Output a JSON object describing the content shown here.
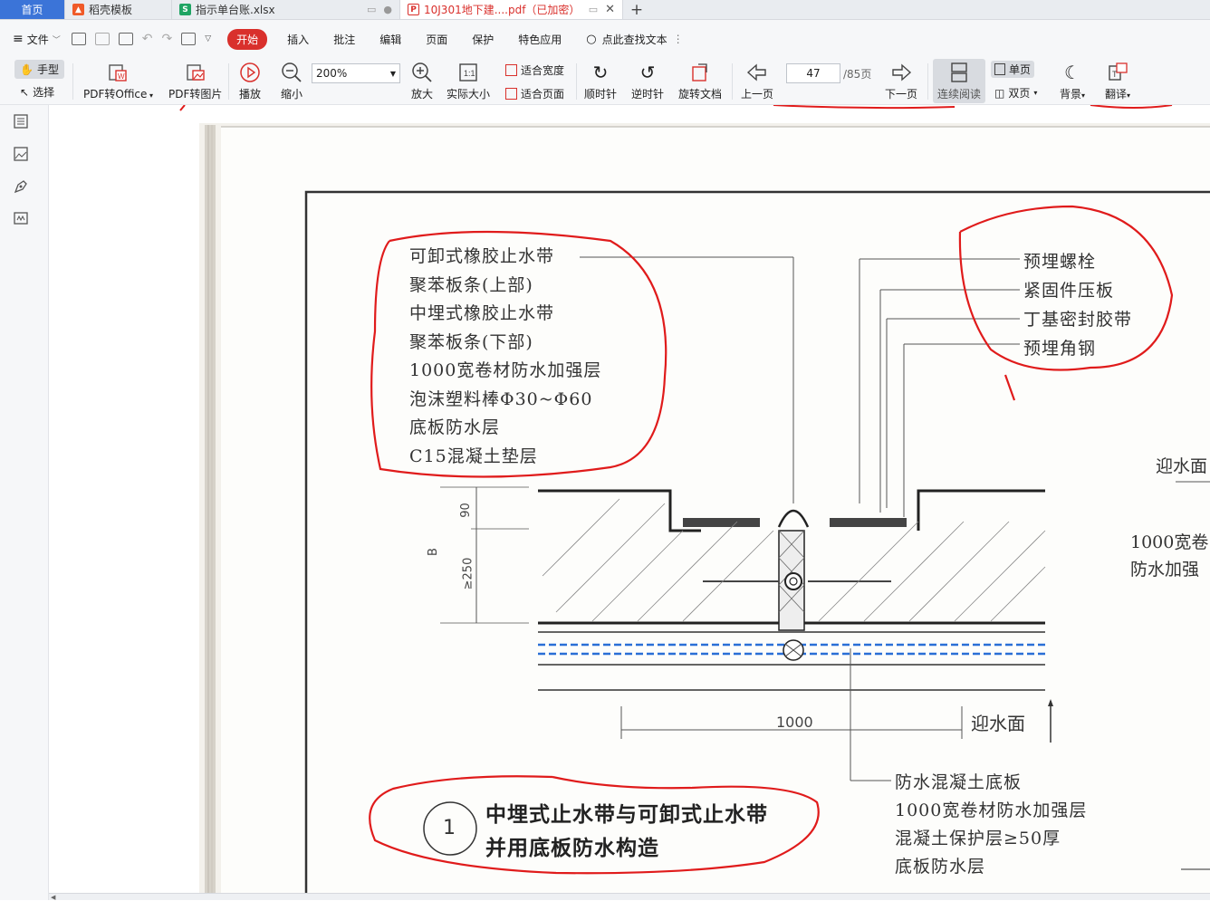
{
  "tabs": [
    {
      "label": "首页"
    },
    {
      "label": "稻壳模板"
    },
    {
      "label": "指示单台账.xlsx"
    },
    {
      "label": "10J301地下建....pdf（已加密）"
    }
  ],
  "menu": {
    "file": "文件",
    "items": [
      "开始",
      "插入",
      "批注",
      "编辑",
      "页面",
      "保护",
      "特色应用"
    ],
    "search": "点此查找文本"
  },
  "ribbon": {
    "hand": "手型",
    "select": "选择",
    "pdf_to_office": "PDF转Office",
    "pdf_to_image": "PDF转图片",
    "play": "播放",
    "zoom_out": "缩小",
    "zoom_value": "200%",
    "zoom_in": "放大",
    "actual_size": "实际大小",
    "fit_width": "适合宽度",
    "fit_page": "适合页面",
    "rotate_cw": "顺时针",
    "rotate_ccw": "逆时针",
    "rotate_doc": "旋转文档",
    "prev_page": "上一页",
    "page_current": "47",
    "page_total": "/85页",
    "next_page": "下一页",
    "continuous": "连续阅读",
    "single": "单页",
    "double": "双页",
    "background": "背景",
    "translate": "翻译"
  },
  "drawing": {
    "labels_left": [
      "可卸式橡胶止水带",
      "聚苯板条(上部)",
      "中埋式橡胶止水带",
      "聚苯板条(下部)",
      "1000宽卷材防水加强层",
      "泡沫塑料棒Φ30~Φ60",
      "底板防水层",
      "C15混凝土垫层"
    ],
    "labels_right": [
      "预埋螺栓",
      "紧固件压板",
      "丁基密封胶带",
      "预埋角钢"
    ],
    "labels_bottom": [
      "防水混凝土底板",
      "1000宽卷材防水加强层",
      "混凝土保护层≥50厚",
      "底板防水层"
    ],
    "side_label_1": "迎水面",
    "side_label_2": "1000宽卷",
    "side_label_3": "防水加强",
    "water_face": "迎水面",
    "dim_1000": "1000",
    "dim_90": "90",
    "dim_250": "≥250",
    "dim_B": "B",
    "detail_no": "1",
    "caption_1": "中埋式止水带与可卸式止水带",
    "caption_2": "并用底板防水构造"
  },
  "colors": {
    "accent": "#3b74d8",
    "active_menu": "#d9302c",
    "annotation": "#e01b1b"
  }
}
